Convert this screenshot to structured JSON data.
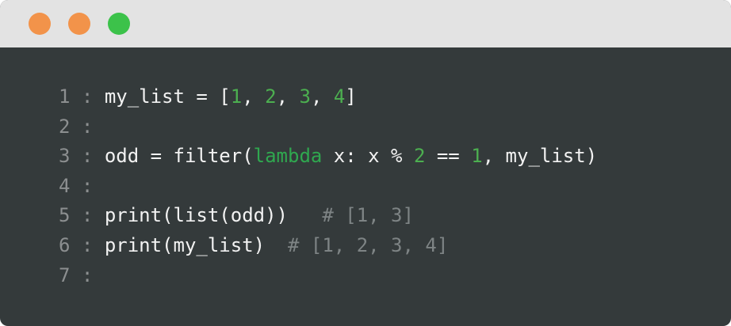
{
  "colors": {
    "close": "#f2934a",
    "minimize": "#f2934a",
    "maximize": "#3cc24a",
    "titlebar": "#e3e3e3",
    "editor_bg": "#343a3b",
    "text": "#f2f2f2",
    "line_number": "#8c8f90",
    "number": "#4caf50",
    "keyword": "#2fa84f",
    "comment": "#7e8485"
  },
  "code": {
    "separator": ":",
    "lines": [
      {
        "number": "1",
        "tokens": [
          {
            "t": "my_list = [",
            "k": "plain"
          },
          {
            "t": "1",
            "k": "num"
          },
          {
            "t": ", ",
            "k": "plain"
          },
          {
            "t": "2",
            "k": "num"
          },
          {
            "t": ", ",
            "k": "plain"
          },
          {
            "t": "3",
            "k": "num"
          },
          {
            "t": ", ",
            "k": "plain"
          },
          {
            "t": "4",
            "k": "num"
          },
          {
            "t": "]",
            "k": "plain"
          }
        ]
      },
      {
        "number": "2",
        "tokens": []
      },
      {
        "number": "3",
        "tokens": [
          {
            "t": "odd = filter(",
            "k": "plain"
          },
          {
            "t": "lambda",
            "k": "kw"
          },
          {
            "t": " x: x % ",
            "k": "plain"
          },
          {
            "t": "2",
            "k": "num"
          },
          {
            "t": " == ",
            "k": "plain"
          },
          {
            "t": "1",
            "k": "num"
          },
          {
            "t": ", my_list)",
            "k": "plain"
          }
        ]
      },
      {
        "number": "4",
        "tokens": []
      },
      {
        "number": "5",
        "tokens": [
          {
            "t": "print(list(odd))",
            "k": "plain"
          },
          {
            "t": "   # [1, 3]",
            "k": "cmt"
          }
        ]
      },
      {
        "number": "6",
        "tokens": [
          {
            "t": "print(my_list)",
            "k": "plain"
          },
          {
            "t": "  # [1, 2, 3, 4]",
            "k": "cmt"
          }
        ]
      },
      {
        "number": "7",
        "tokens": []
      }
    ]
  }
}
